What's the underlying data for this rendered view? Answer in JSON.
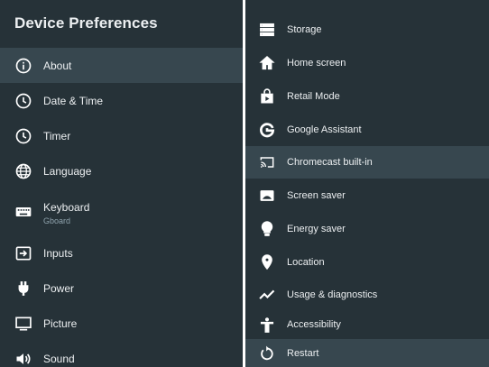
{
  "left": {
    "title": "Device Preferences",
    "items": [
      {
        "label": "About",
        "icon": "info-icon"
      },
      {
        "label": "Date & Time",
        "icon": "clock-icon"
      },
      {
        "label": "Timer",
        "icon": "timer-icon"
      },
      {
        "label": "Language",
        "icon": "globe-icon"
      },
      {
        "label": "Keyboard",
        "sub": "Gboard",
        "icon": "keyboard-icon"
      },
      {
        "label": "Inputs",
        "icon": "input-icon"
      },
      {
        "label": "Power",
        "icon": "power-plug-icon"
      },
      {
        "label": "Picture",
        "icon": "monitor-icon"
      },
      {
        "label": "Sound",
        "icon": "speaker-icon"
      }
    ]
  },
  "right": {
    "items": [
      {
        "label": "Storage",
        "icon": "storage-icon"
      },
      {
        "label": "Home screen",
        "icon": "home-icon"
      },
      {
        "label": "Retail Mode",
        "icon": "shopping-bag-icon"
      },
      {
        "label": "Google Assistant",
        "icon": "google-g-icon"
      },
      {
        "label": "Chromecast built-in",
        "icon": "cast-icon"
      },
      {
        "label": "Screen saver",
        "icon": "screen-saver-icon"
      },
      {
        "label": "Energy saver",
        "icon": "lightbulb-icon"
      },
      {
        "label": "Location",
        "icon": "location-pin-icon"
      },
      {
        "label": "Usage & diagnostics",
        "icon": "trend-line-icon"
      },
      {
        "label": "Accessibility",
        "icon": "accessibility-icon"
      },
      {
        "label": "Restart",
        "icon": "restart-icon"
      }
    ]
  },
  "colors": {
    "panel_bg": "#263238",
    "selected_bg": "#37474f",
    "text": "#eceff1",
    "subtext": "#90a4ae"
  }
}
